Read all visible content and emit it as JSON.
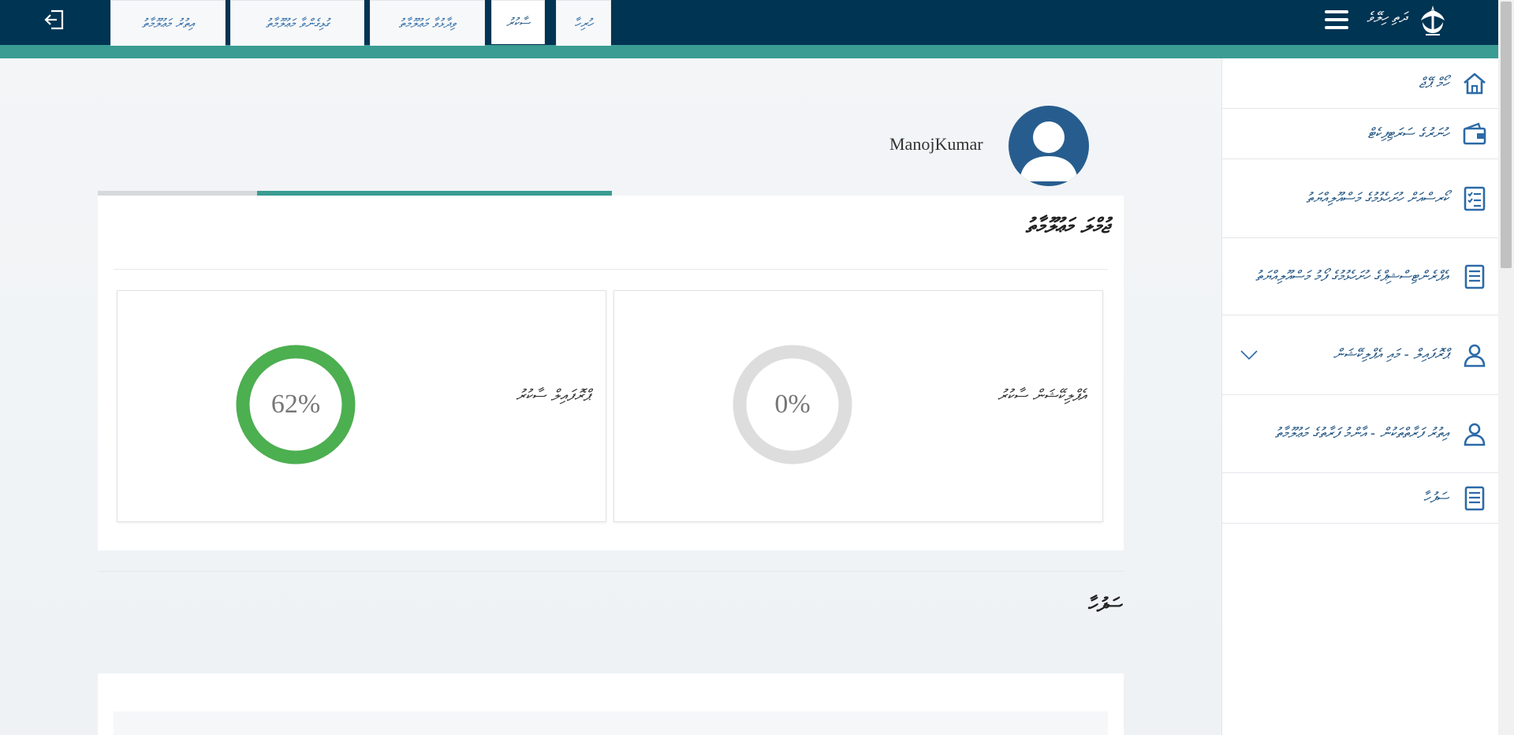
{
  "header": {
    "site_title": "ދަތި ހިލޭވެ",
    "colors": {
      "bar": "#003453",
      "stripe": "#3a9c92"
    }
  },
  "sidebar": {
    "items": [
      {
        "label": "ހޯމް ޕޭޖް",
        "icon": "home-icon"
      },
      {
        "label": "ހުނަރުގެ ސަރަޓިފިކެޓް",
        "icon": "wallet-icon"
      },
      {
        "label": "ކޯރސްއަށް ހުށަހެޅުމުގެ މަސްއޫލިއްޔަތު",
        "icon": "checklist-icon"
      },
      {
        "label": "އެޕްރެންޓިސްޝިޕްގެ ހުށަހެޅުމުގެ ފޯމު މަސްއޫލިއްޔަތު",
        "icon": "document-icon"
      },
      {
        "label": "ޕްރޮފައިލް - މައި އެޕްލިކޭޝަން",
        "icon": "user-icon",
        "has_dropdown": true
      },
      {
        "label": "އިތުރު ފަރާތްތަކުން - އާންމު ފަރާތުގެ މަޢުލޫމާތު",
        "icon": "user-icon"
      },
      {
        "label": "ސަފުހާ",
        "icon": "document-icon"
      }
    ]
  },
  "profile": {
    "username": "ManojKumar"
  },
  "tabs": [
    {
      "label": "ހުރިހާ",
      "active": false
    },
    {
      "label": "ސާކުރު",
      "active": true
    },
    {
      "label": "ވިދާޅުވާ މަޢުލޫމާތު",
      "active": false
    },
    {
      "label": "ގުޅިގެންވާ މަޢުލޫމާތު",
      "active": false
    },
    {
      "label": "އިތުރު މަޢުލޫމާތު",
      "active": false
    }
  ],
  "panel": {
    "title": "ޖުމްލަ މަޢުލޫމާތު",
    "cards": [
      {
        "label": "އެޕްލިކޭޝަން ސާކުރު",
        "percent_text": "0%",
        "value": 0,
        "color": "#dddddd"
      },
      {
        "label": "ޕްރޮފައިލް ސާކުރު",
        "percent_text": "62%",
        "value": 62,
        "color": "#4caf50"
      }
    ]
  },
  "section": {
    "title": "ސަފުހާ"
  }
}
